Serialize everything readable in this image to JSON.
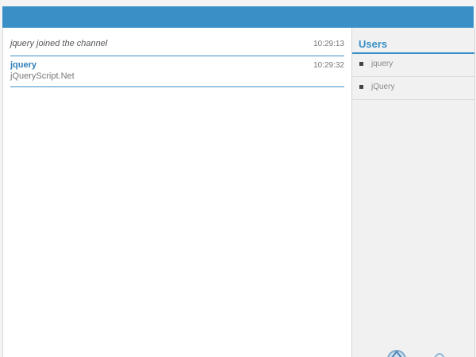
{
  "messages": [
    {
      "type": "system",
      "text": "jquery joined the channel",
      "time": "10:29:13"
    },
    {
      "type": "user",
      "author": "jquery",
      "body": "jQueryScript.Net",
      "time": "10:29:32"
    }
  ],
  "sidebar": {
    "title": "Users",
    "users": [
      {
        "name": "jquery"
      },
      {
        "name": "jQuery"
      }
    ]
  },
  "colors": {
    "accent": "#3a8fc7",
    "sidebar_bg": "#f1f1f1"
  }
}
